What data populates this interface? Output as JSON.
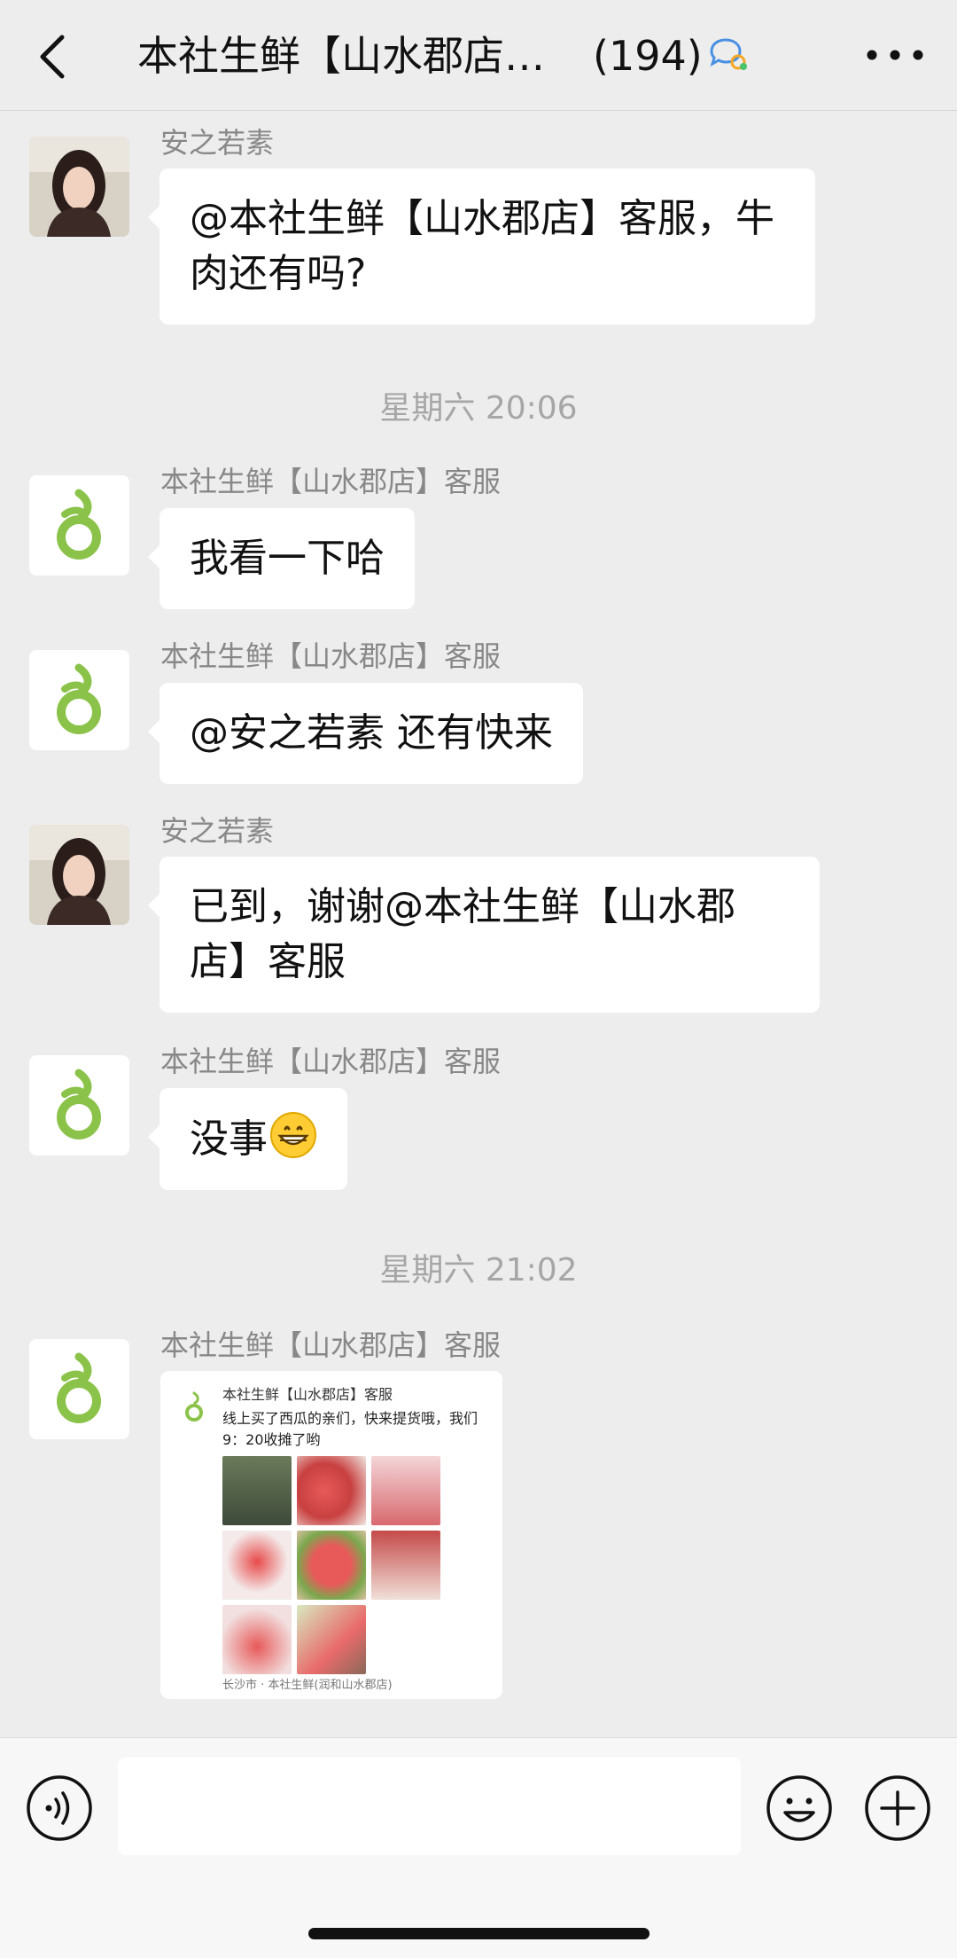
{
  "header": {
    "title": "本社生鲜【山水郡店】...",
    "member_count": "(194)",
    "back_icon": "chevron-left-icon",
    "chat_icon": "chat-bubbles-icon",
    "more_icon": "more-horizontal-icon"
  },
  "messages": [
    {
      "sender": "安之若素",
      "text": "@本社生鲜【山水郡店】客服，牛肉还有吗?"
    },
    {
      "timestamp": "星期六 20:06"
    },
    {
      "sender": "本社生鲜【山水郡店】客服",
      "text": "我看一下哈"
    },
    {
      "sender": "本社生鲜【山水郡店】客服",
      "text": "@安之若素 还有快来"
    },
    {
      "sender": "安之若素",
      "text": "已到，谢谢@本社生鲜【山水郡店】客服"
    },
    {
      "sender": "本社生鲜【山水郡店】客服",
      "text": "没事",
      "emoji": "grinning-face-icon"
    },
    {
      "timestamp": "星期六 21:02"
    },
    {
      "sender": "本社生鲜【山水郡店】客服"
    }
  ],
  "shared_card": {
    "title": "本社生鲜【山水郡店】客服",
    "text": "线上买了西瓜的亲们，快来提货哦，我们9：20收摊了哟",
    "location": "长沙市 · 本社生鲜(润和山水郡店)"
  },
  "input_bar": {
    "placeholder": "",
    "voice_icon": "voice-icon",
    "emoji_icon": "emoji-icon",
    "plus_icon": "plus-icon"
  },
  "colors": {
    "background": "#ededed",
    "bubble": "#ffffff",
    "brand_green": "#8bc34a",
    "watermelon": "#e85a5a"
  }
}
